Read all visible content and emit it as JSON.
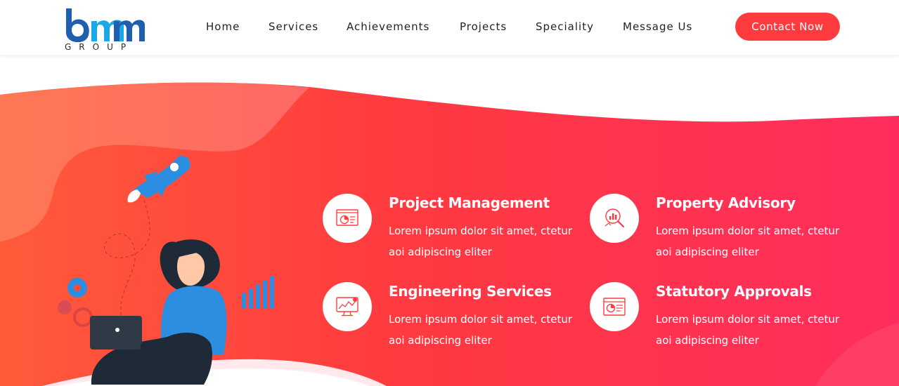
{
  "brand": {
    "logo_text": "bmm",
    "logo_subtext": "GROUP",
    "logo_color": "#1f5fad",
    "logo_accent": "#1aa9e6"
  },
  "nav": {
    "items": [
      {
        "label": "Home"
      },
      {
        "label": "Services"
      },
      {
        "label": "Achievements"
      },
      {
        "label": "Projects"
      },
      {
        "label": "Speciality"
      },
      {
        "label": "Message Us"
      }
    ],
    "cta_label": "Contact Now"
  },
  "colors": {
    "accent": "#ff3b3f",
    "hero_gradient_start": "#ff4e3a",
    "hero_gradient_end": "#ff2d5e",
    "illustration_blue": "#2b8ee0"
  },
  "services": [
    {
      "title": "Project Management",
      "description": "Lorem ipsum dolor sit amet, ctetur aoi adipiscing eliter",
      "icon": "presentation-chart-icon"
    },
    {
      "title": "Property Advisory",
      "description": "Lorem ipsum dolor sit amet, ctetur aoi adipiscing eliter",
      "icon": "magnifier-chart-icon"
    },
    {
      "title": "Engineering Services",
      "description": "Lorem ipsum dolor sit amet, ctetur aoi adipiscing eliter",
      "icon": "monitor-analytics-icon"
    },
    {
      "title": "Statutory Approvals",
      "description": "Lorem ipsum dolor sit amet, ctetur aoi adipiscing eliter",
      "icon": "document-chart-icon"
    }
  ]
}
